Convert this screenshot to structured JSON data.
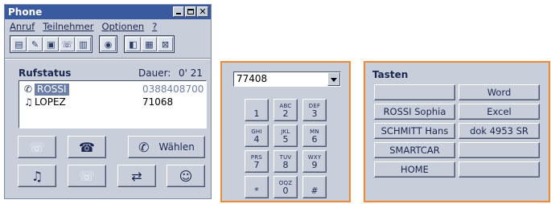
{
  "window": {
    "title": "Phone"
  },
  "menu": [
    "Anruf",
    "Teilnehmer",
    "Optionen",
    "?"
  ],
  "toolbar_icons": [
    "notes-icon",
    "tools-icon",
    "monitor-icon",
    "phone-card-icon",
    "book-icon",
    "dial-icon",
    "grid-icon",
    "mark-icon"
  ],
  "rufstatus": {
    "label": "Rufstatus",
    "dauer_label": "Dauer:",
    "dauer_value": "0' 21",
    "calls": [
      {
        "icon": "handset-icon",
        "name": "ROSSI",
        "number": "0388408700",
        "selected": true
      },
      {
        "icon": "music-note-icon",
        "name": "LOPEZ",
        "number": "71068",
        "selected": false
      }
    ]
  },
  "actions": {
    "waehlen_label": "Wählen"
  },
  "dialer": {
    "input_value": "77408",
    "keys": [
      {
        "letters": "",
        "digit": "1"
      },
      {
        "letters": "ABC",
        "digit": "2"
      },
      {
        "letters": "DEF",
        "digit": "3"
      },
      {
        "letters": "GHI",
        "digit": "4"
      },
      {
        "letters": "JKL",
        "digit": "5"
      },
      {
        "letters": "MN",
        "digit": "6"
      },
      {
        "letters": "PRS",
        "digit": "7"
      },
      {
        "letters": "TUV",
        "digit": "8"
      },
      {
        "letters": "WXY",
        "digit": "9"
      },
      {
        "letters": "",
        "digit": "*"
      },
      {
        "letters": "OQZ",
        "digit": "0"
      },
      {
        "letters": "",
        "digit": "#"
      }
    ]
  },
  "tasten": {
    "title": "Tasten",
    "keys": [
      "",
      "Word",
      "ROSSI Sophia",
      "Excel",
      "SCHMITT Hans",
      "dok 4953 SR",
      "SMARTCAR",
      "",
      "HOME",
      ""
    ]
  },
  "colors": {
    "accent_border": "#ee8a35",
    "panel_bg": "#c8cfdb",
    "title_bar": "#3a5aa0",
    "selection": "#6c7fa8"
  }
}
